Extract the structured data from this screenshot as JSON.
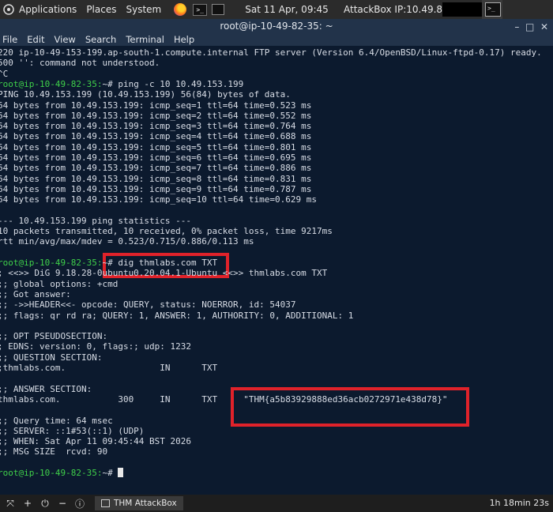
{
  "topbar": {
    "applications": "Applications",
    "places": "Places",
    "system": "System",
    "clock": "Sat 11 Apr, 09:45",
    "ip": "AttackBox IP:10.49.82.35"
  },
  "window": {
    "title": "root@ip-10-49-82-35: ~",
    "menu": [
      "File",
      "Edit",
      "View",
      "Search",
      "Terminal",
      "Help"
    ]
  },
  "terminal": {
    "prompt": "root@ip-10-49-82-35:",
    "lines": [
      "220 ip-10-49-153-199.ap-south-1.compute.internal FTP server (Version 6.4/OpenBSD/Linux-ftpd-0.17) ready.",
      "500 '': command not understood.",
      "^C",
      "",
      "PING 10.49.153.199 (10.49.153.199) 56(84) bytes of data.",
      "64 bytes from 10.49.153.199: icmp_seq=1 ttl=64 time=0.523 ms",
      "64 bytes from 10.49.153.199: icmp_seq=2 ttl=64 time=0.552 ms",
      "64 bytes from 10.49.153.199: icmp_seq=3 ttl=64 time=0.764 ms",
      "64 bytes from 10.49.153.199: icmp_seq=4 ttl=64 time=0.688 ms",
      "64 bytes from 10.49.153.199: icmp_seq=5 ttl=64 time=0.801 ms",
      "64 bytes from 10.49.153.199: icmp_seq=6 ttl=64 time=0.695 ms",
      "64 bytes from 10.49.153.199: icmp_seq=7 ttl=64 time=0.886 ms",
      "64 bytes from 10.49.153.199: icmp_seq=8 ttl=64 time=0.831 ms",
      "64 bytes from 10.49.153.199: icmp_seq=9 ttl=64 time=0.787 ms",
      "64 bytes from 10.49.153.199: icmp_seq=10 ttl=64 time=0.629 ms",
      "",
      "--- 10.49.153.199 ping statistics ---",
      "10 packets transmitted, 10 received, 0% packet loss, time 9217ms",
      "rtt min/avg/max/mdev = 0.523/0.715/0.886/0.113 ms",
      "",
      "",
      "; <<>> DiG 9.18.28-0ubuntu0.20.04.1-Ubuntu <<>> thmlabs.com TXT",
      ";; global options: +cmd",
      ";; Got answer:",
      ";; ->>HEADER<<- opcode: QUERY, status: NOERROR, id: 54037",
      ";; flags: qr rd ra; QUERY: 1, ANSWER: 1, AUTHORITY: 0, ADDITIONAL: 1",
      "",
      ";; OPT PSEUDOSECTION:",
      "; EDNS: version: 0, flags:; udp: 1232",
      ";; QUESTION SECTION:",
      ";thmlabs.com.                  IN      TXT",
      "",
      ";; ANSWER SECTION:",
      "thmlabs.com.           300     IN      TXT     \"THM{a5b83929888ed36acb0272971e438d78}\"",
      "",
      ";; Query time: 64 msec",
      ";; SERVER: ::1#53(::1) (UDP)",
      ";; WHEN: Sat Apr 11 09:45:44 BST 2026",
      ";; MSG SIZE  rcvd: 90",
      "",
      ""
    ],
    "cmd_ping": "~# ping -c 10 10.49.153.199",
    "cmd_dig": "~# dig thmlabs.com TXT",
    "cmd_last": "~# "
  },
  "bottombar": {
    "task_label": "THM AttackBox",
    "timer": "1h 18min 23s"
  },
  "colors": {
    "terminal_bg": "#0c1a2e",
    "prompt": "#3fd04a",
    "highlight": "#e0222a"
  }
}
